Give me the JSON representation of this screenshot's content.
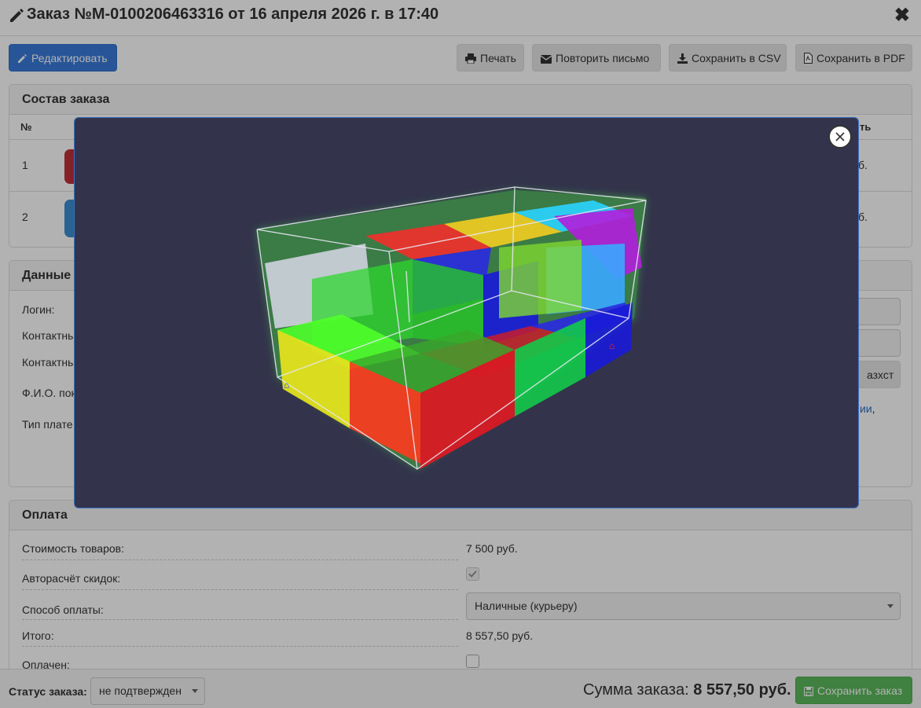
{
  "header": {
    "title": "Заказ №М-0100206463316 от 16 апреля 2026 г. в 17:40"
  },
  "toolbar": {
    "edit": "Редактировать",
    "print": "Печать",
    "resend": "Повторить письмо",
    "csv": "Сохранить в CSV",
    "pdf": "Сохранить в PDF"
  },
  "composition": {
    "title": "Состав заказа",
    "col_num": "№",
    "col_last_fragment": "ть",
    "rows": [
      {
        "num": "1",
        "price_fragment": "б."
      },
      {
        "num": "2",
        "price_fragment": "б."
      }
    ],
    "thumb_colors": [
      "#c0303a",
      "#3a8fd0"
    ]
  },
  "customer": {
    "title_fragment": "Данные",
    "login": "Логин:",
    "contact1": "Контактны",
    "contact2": "Контактны",
    "fio": "Ф.И.О. пок",
    "pay_type": "Тип плате",
    "btn_fragment": "азхст",
    "link_fragment": "ии",
    "comma": ","
  },
  "payment": {
    "title": "Оплата",
    "goods_cost_label": "Стоимость товаров:",
    "goods_cost_value": "7 500 руб.",
    "auto_discount_label": "Авторасчёт скидок:",
    "method_label": "Способ оплаты:",
    "method_value": "Наличные (курьеру)",
    "total_label": "Итого:",
    "total_value": "8 557,50 руб.",
    "paid_label": "Оплачен:"
  },
  "footer": {
    "status_label": "Статус заказа:",
    "status_value": "не подтвержден",
    "sum_label": "Сумма заказа:",
    "sum_value": "8 557,50 руб.",
    "save": "Сохранить заказ"
  },
  "colors": {
    "primary": "#3a7ad9",
    "success": "#5cb85c",
    "modal_bg": "#33344c",
    "link": "#2a6fc2"
  }
}
